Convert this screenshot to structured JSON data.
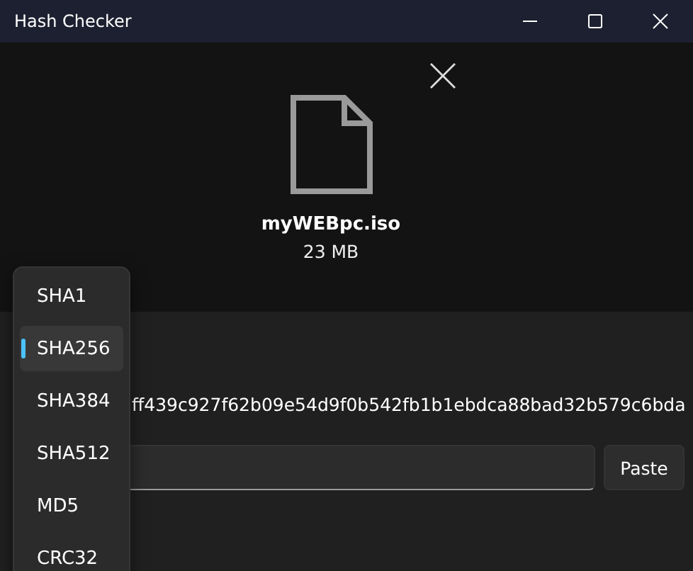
{
  "window": {
    "title": "Hash Checker"
  },
  "file": {
    "name": "myWEBpc.iso",
    "size": "23 MB"
  },
  "hash": {
    "value": "ff439c927f62b09e54d9f0b542fb1b1ebdca88bad32b579c6bda"
  },
  "compare": {
    "button": "Paste"
  },
  "algorithm_menu": {
    "items": [
      {
        "label": "SHA1",
        "selected": false
      },
      {
        "label": "SHA256",
        "selected": true
      },
      {
        "label": "SHA384",
        "selected": false
      },
      {
        "label": "SHA512",
        "selected": false
      },
      {
        "label": "MD5",
        "selected": false
      },
      {
        "label": "CRC32",
        "selected": false
      }
    ]
  }
}
